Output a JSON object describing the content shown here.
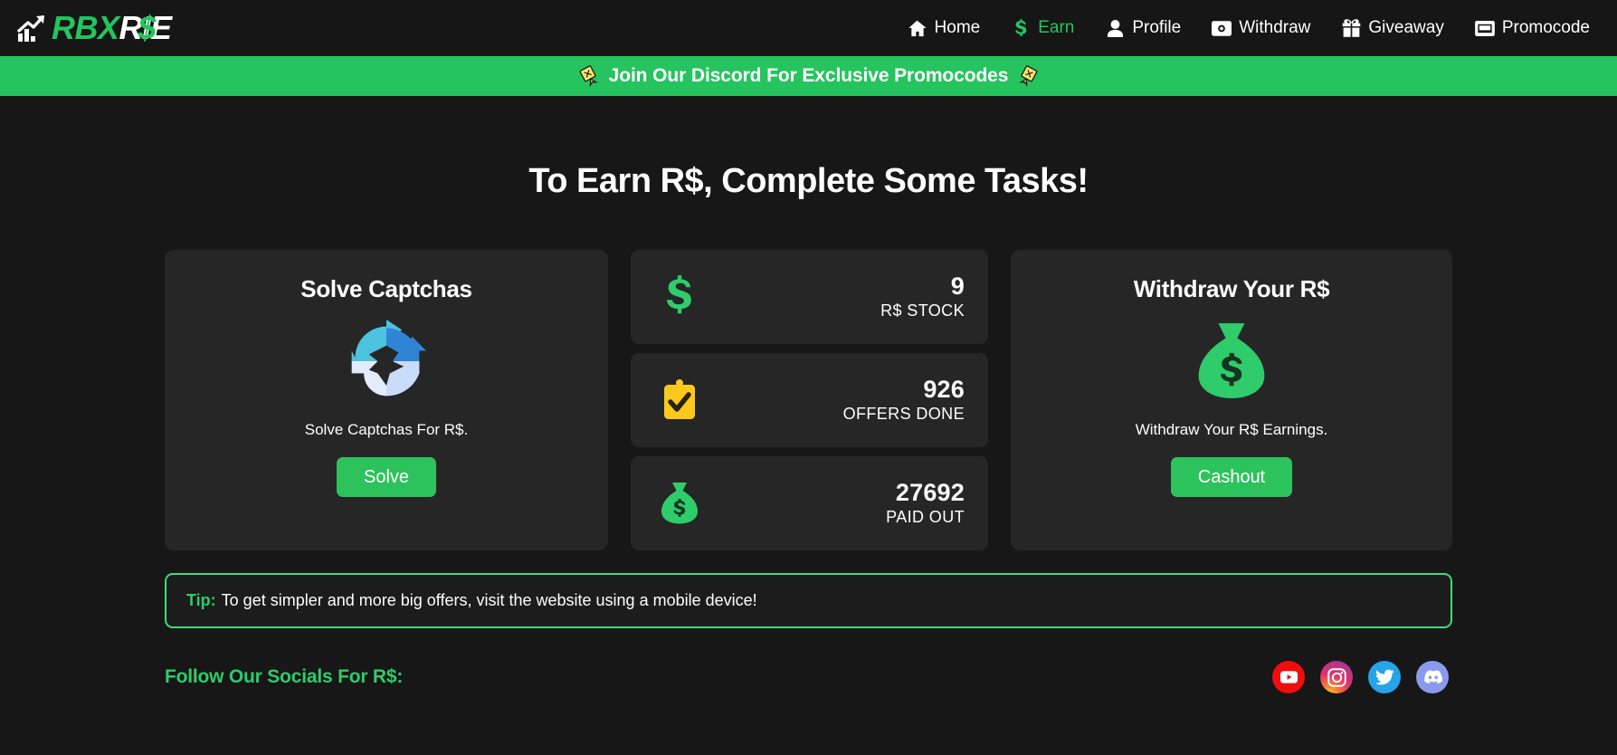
{
  "brand": {
    "mark_icon": "chart-arrow-up-icon",
    "part1": "RBX",
    "part2": "RI",
    "dollar": "$",
    "part3": "E"
  },
  "nav": {
    "items": [
      {
        "label": "Home",
        "icon": "home-icon",
        "active": false
      },
      {
        "label": "Earn",
        "icon": "dollar-icon",
        "active": true
      },
      {
        "label": "Profile",
        "icon": "user-icon",
        "active": false
      },
      {
        "label": "Withdraw",
        "icon": "money-bill-icon",
        "active": false
      },
      {
        "label": "Giveaway",
        "icon": "gift-icon",
        "active": false
      },
      {
        "label": "Promocode",
        "icon": "ticket-icon",
        "active": false
      }
    ]
  },
  "promo_banner": {
    "text": "Join Our Discord For Exclusive Promocodes",
    "left_icon": "confetti-icon",
    "right_icon": "confetti-icon",
    "background_color": "#25c45e"
  },
  "main": {
    "title": "To Earn R$, Complete Some Tasks!"
  },
  "captcha_card": {
    "title": "Solve Captchas",
    "icon": "refresh-arrows-icon",
    "description": "Solve Captchas For R$.",
    "button_label": "Solve"
  },
  "stats": [
    {
      "value": "9",
      "label": "R$ STOCK",
      "icon": "dollar-sign-icon",
      "icon_color": "#2ecc6b"
    },
    {
      "value": "926",
      "label": "OFFERS DONE",
      "icon": "clipboard-check-icon",
      "icon_color": "#fbc91b"
    },
    {
      "value": "27692",
      "label": "PAID OUT",
      "icon": "money-bag-icon",
      "icon_color": "#2ecc6b"
    }
  ],
  "withdraw_card": {
    "title": "Withdraw Your R$",
    "icon": "money-bag-icon",
    "description": "Withdraw Your R$ Earnings.",
    "button_label": "Cashout"
  },
  "tip": {
    "label": "Tip:",
    "text": "To get simpler and more big offers, visit the website using a mobile device!",
    "border_color": "#3ddc7a"
  },
  "footer": {
    "socials_title": "Follow Our Socials For R$:",
    "socials": [
      {
        "name": "youtube",
        "icon": "youtube-icon",
        "color": "#ef0e0e"
      },
      {
        "name": "instagram",
        "icon": "instagram-icon",
        "color": "#e1306c"
      },
      {
        "name": "twitter",
        "icon": "twitter-icon",
        "color": "#27a3e8"
      },
      {
        "name": "discord",
        "icon": "discord-icon",
        "color": "#8a9bee"
      }
    ]
  },
  "theme": {
    "page_bg": "#171717",
    "header_bg": "#161616",
    "card_bg": "#262626",
    "accent_green": "#22c55e"
  }
}
